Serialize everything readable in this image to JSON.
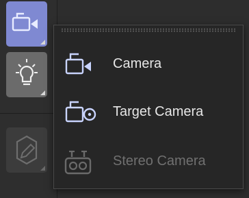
{
  "toolbar": {
    "tools": [
      {
        "icon": "camera-icon",
        "state": "active"
      },
      {
        "icon": "light-icon",
        "state": "normal"
      },
      {
        "icon": "pencil-icon",
        "state": "disabled"
      }
    ]
  },
  "flyout": {
    "items": [
      {
        "label": "Camera",
        "icon": "camera-icon",
        "enabled": true
      },
      {
        "label": "Target Camera",
        "icon": "target-camera-icon",
        "enabled": true
      },
      {
        "label": "Stereo Camera",
        "icon": "stereo-camera-icon",
        "enabled": false
      }
    ]
  },
  "colors": {
    "active_tool_bg": "#7f89d2",
    "icon_tint": "#c9d4ff",
    "menu_bg": "#262626",
    "disabled_text": "#707070"
  }
}
